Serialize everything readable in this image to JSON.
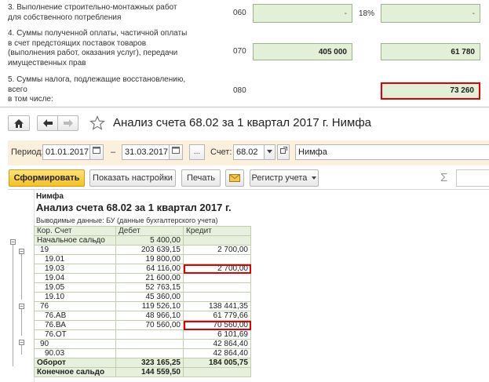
{
  "declaration": {
    "rows": [
      {
        "label": "3. Выполнение строительно-монтажных работ\nдля собственного потребления",
        "code": "060",
        "base": "-",
        "rate": "18%",
        "tax": "-"
      },
      {
        "label": "4. Суммы полученной оплаты, частичной оплаты\nв счет предстоящих поставок товаров\n(выполнения работ, оказания услуг), передачи\nимущественных прав",
        "code": "070",
        "base": "405 000",
        "tax": "61 780"
      },
      {
        "label": "5. Суммы налога, подлежащие восстановлению,\nвсего\nв том числе:",
        "code": "080",
        "tax": "73 260"
      }
    ]
  },
  "window": {
    "title": "Анализ счета 68.02 за 1 квартал 2017 г. Нимфа",
    "home_icon": "home-icon",
    "back_icon": "arrow-left-icon",
    "forward_icon": "arrow-right-icon",
    "favorite_icon": "star-icon"
  },
  "filters": {
    "period_label": "Период:",
    "date_from": "01.01.2017",
    "dash": "–",
    "date_to": "31.03.2017",
    "ellipsis": "...",
    "account_label": "Счет:",
    "account": "68.02",
    "organization": "Нимфа"
  },
  "toolbar": {
    "generate": "Сформировать",
    "settings": "Показать настройки",
    "print": "Печать",
    "register": "Регистр учета",
    "sum_symbol": "Σ"
  },
  "report": {
    "org": "Нимфа",
    "title": "Анализ счета 68.02 за 1 квартал 2017 г.",
    "params": "Выводимые данные:  БУ (данные бухгалтерского учета)",
    "headers": [
      "Кор. Счет",
      "Дебет",
      "Кредит"
    ],
    "rows": [
      {
        "account": "Начальное сальдо",
        "debit": "5 400,00",
        "credit": ""
      },
      {
        "account": "19",
        "debit": "203 639,15",
        "credit": "2 700,00"
      },
      {
        "account": "19.01",
        "debit": "19 800,00",
        "credit": ""
      },
      {
        "account": "19.03",
        "debit": "64 116,00",
        "credit": "2 700,00"
      },
      {
        "account": "19.04",
        "debit": "21 600,00",
        "credit": ""
      },
      {
        "account": "19.05",
        "debit": "52 763,15",
        "credit": ""
      },
      {
        "account": "19.10",
        "debit": "45 360,00",
        "credit": ""
      },
      {
        "account": "76",
        "debit": "119 526,10",
        "credit": "138 441,35"
      },
      {
        "account": "76.АВ",
        "debit": "48 966,10",
        "credit": "61 779,66"
      },
      {
        "account": "76.ВА",
        "debit": "70 560,00",
        "credit": "70 560,00"
      },
      {
        "account": "76.ОТ",
        "debit": "",
        "credit": "6 101,69"
      },
      {
        "account": "90",
        "debit": "",
        "credit": "42 864,40"
      },
      {
        "account": "90.03",
        "debit": "",
        "credit": "42 864,40"
      },
      {
        "account": "Оборот",
        "debit": "323 165,25",
        "credit": "184 005,75"
      },
      {
        "account": "Конечное сальдо",
        "debit": "144 559,50",
        "credit": ""
      }
    ]
  }
}
